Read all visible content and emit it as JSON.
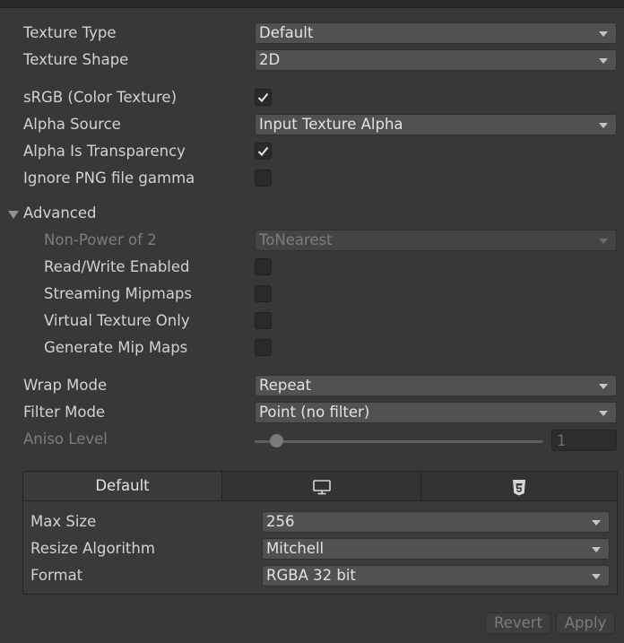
{
  "texture_type": {
    "label": "Texture Type",
    "value": "Default"
  },
  "texture_shape": {
    "label": "Texture Shape",
    "value": "2D"
  },
  "srgb": {
    "label": "sRGB (Color Texture)",
    "checked": true
  },
  "alpha_source": {
    "label": "Alpha Source",
    "value": "Input Texture Alpha"
  },
  "alpha_is_transparency": {
    "label": "Alpha Is Transparency",
    "checked": true
  },
  "ignore_png_gamma": {
    "label": "Ignore PNG file gamma",
    "checked": false
  },
  "advanced": {
    "label": "Advanced",
    "non_power_of_2": {
      "label": "Non-Power of 2",
      "value": "ToNearest"
    },
    "read_write": {
      "label": "Read/Write Enabled",
      "checked": false
    },
    "streaming_mipmaps": {
      "label": "Streaming Mipmaps",
      "checked": false
    },
    "virtual_texture_only": {
      "label": "Virtual Texture Only",
      "checked": false
    },
    "generate_mip_maps": {
      "label": "Generate Mip Maps",
      "checked": false
    }
  },
  "wrap_mode": {
    "label": "Wrap Mode",
    "value": "Repeat"
  },
  "filter_mode": {
    "label": "Filter Mode",
    "value": "Point (no filter)"
  },
  "aniso_level": {
    "label": "Aniso Level",
    "value": "1"
  },
  "platform_tabs": [
    {
      "label": "Default",
      "icon": "none",
      "active": true
    },
    {
      "label": "",
      "icon": "monitor-icon",
      "active": false
    },
    {
      "label": "",
      "icon": "html5-icon",
      "active": false
    }
  ],
  "platform_settings": {
    "max_size": {
      "label": "Max Size",
      "value": "256"
    },
    "resize_algorithm": {
      "label": "Resize Algorithm",
      "value": "Mitchell"
    },
    "format": {
      "label": "Format",
      "value": "RGBA 32 bit"
    }
  },
  "buttons": {
    "revert": "Revert",
    "apply": "Apply"
  },
  "colors": {
    "background": "#383838",
    "field": "#515151",
    "text": "#d2d2d2",
    "disabled_text": "#7d7d7d"
  }
}
